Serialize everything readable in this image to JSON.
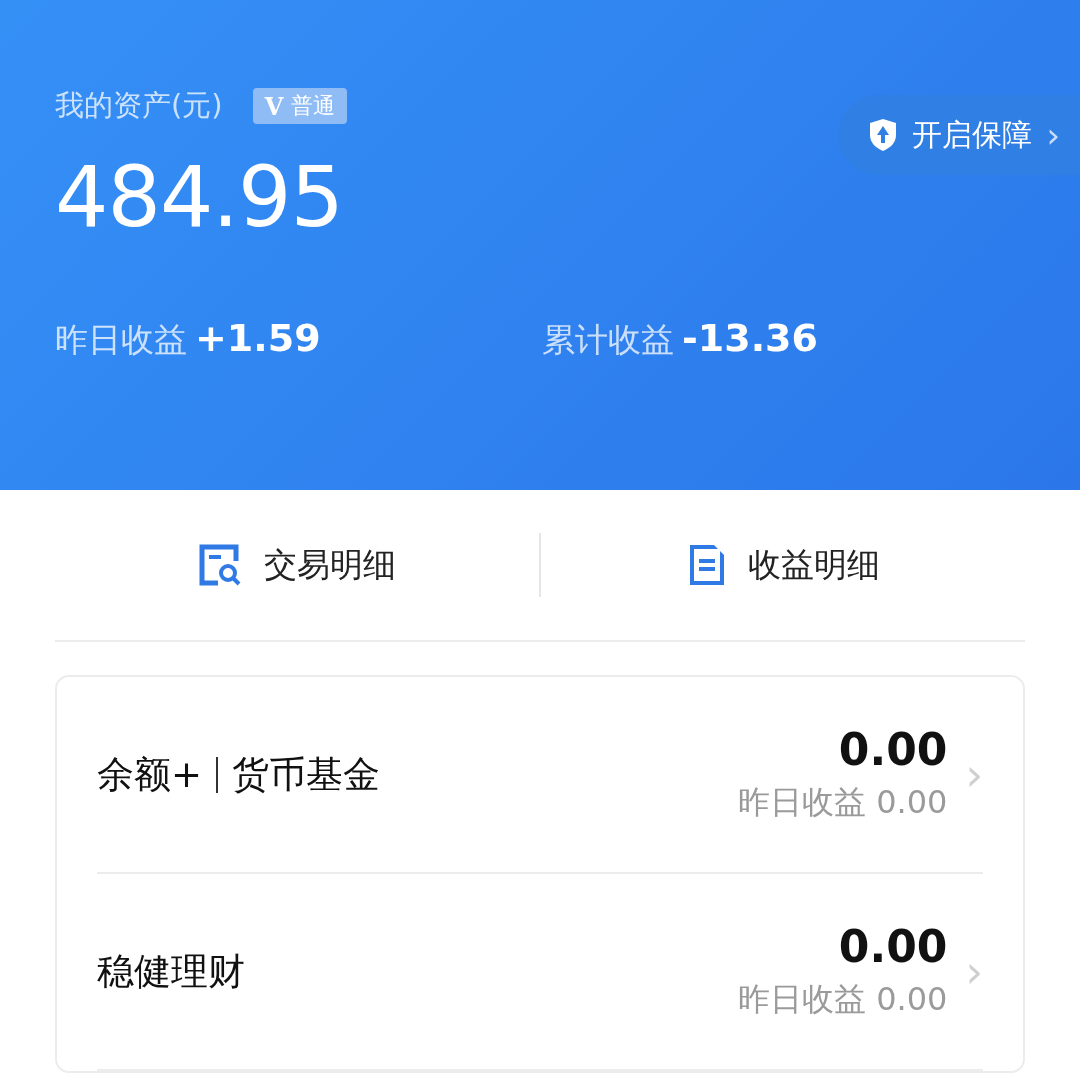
{
  "header": {
    "assets_label": "我的资产(元)",
    "badge": {
      "letter": "V",
      "label": "普通"
    },
    "total": "484.95",
    "protect_button": {
      "label": "开启保障",
      "chevron": "›"
    },
    "earnings": [
      {
        "label": "昨日收益",
        "value": "+1.59"
      },
      {
        "label": "累计收益",
        "value": "-13.36"
      }
    ]
  },
  "links": [
    {
      "kind": "search",
      "label": "交易明细"
    },
    {
      "kind": "doc",
      "label": "收益明细"
    }
  ],
  "products": [
    {
      "name": "余额+",
      "tag": "货币基金",
      "amount": "0.00",
      "yesterday": "昨日收益 0.00",
      "chevron": "›"
    },
    {
      "name": "稳健理财",
      "amount": "0.00",
      "yesterday": "昨日收益 0.00",
      "chevron": "›"
    }
  ]
}
